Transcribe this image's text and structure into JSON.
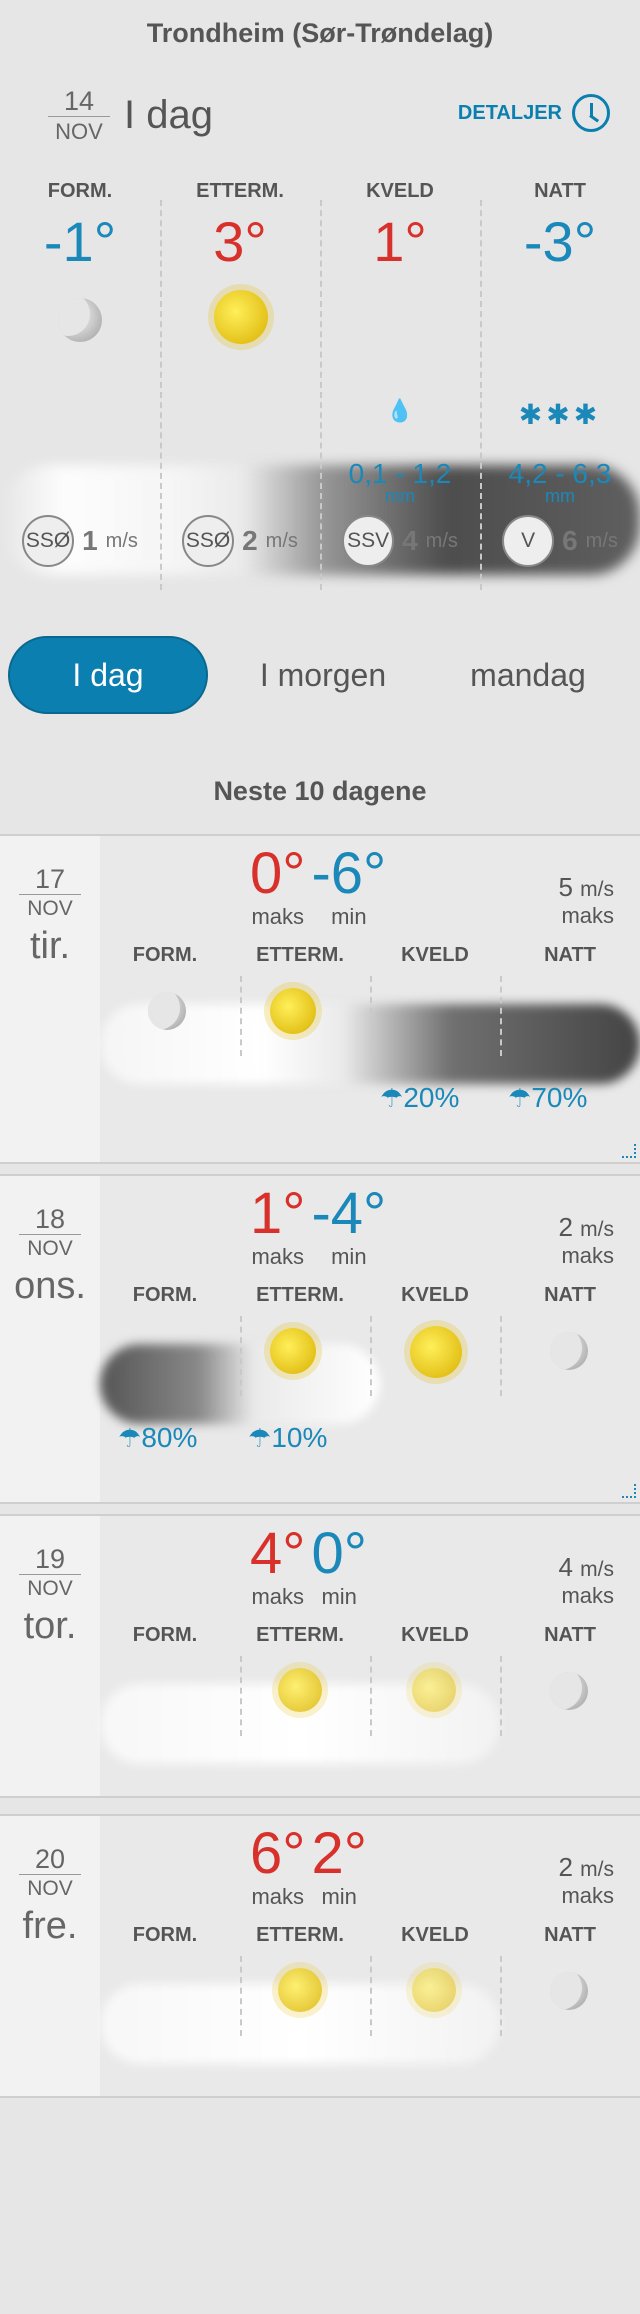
{
  "title": "Trondheim (Sør-Trøndelag)",
  "today": {
    "day": "14",
    "month": "NOV",
    "label": "I dag",
    "details": "DETALJER"
  },
  "periods": [
    {
      "label": "FORM.",
      "temp": "-1°",
      "color": "#1a88b8",
      "icon": "moon-icon",
      "precip": "",
      "precip_unit": "",
      "wind_dir": "SSØ",
      "wind_speed": "1",
      "wind_unit": "m/s"
    },
    {
      "label": "ETTERM.",
      "temp": "3°",
      "color": "#d8302a",
      "icon": "sun-icon",
      "precip": "",
      "precip_unit": "",
      "wind_dir": "SSØ",
      "wind_speed": "2",
      "wind_unit": "m/s"
    },
    {
      "label": "KVELD",
      "temp": "1°",
      "color": "#d8302a",
      "icon": "rain-icon",
      "precip": "0,1 - 1,2",
      "precip_unit": "mm",
      "wind_dir": "SSV",
      "wind_speed": "4",
      "wind_unit": "m/s"
    },
    {
      "label": "NATT",
      "temp": "-3°",
      "color": "#1a88b8",
      "icon": "snow-icon",
      "precip": "4,2 - 6,3",
      "precip_unit": "mm",
      "wind_dir": "V",
      "wind_speed": "6",
      "wind_unit": "m/s"
    }
  ],
  "tabs": [
    "I dag",
    "I morgen",
    "mandag"
  ],
  "next_title": "Neste 10 dagene",
  "col_labels": [
    "FORM.",
    "ETTERM.",
    "KVELD",
    "NATT"
  ],
  "days": [
    {
      "day": "17",
      "month": "NOV",
      "weekday": "tir.",
      "max": "0°",
      "min": "-6°",
      "max_color": "#d8302a",
      "min_color": "#1a88b8",
      "wind": "5",
      "wind_unit": "m/s",
      "wind_label": "maks",
      "max_label": "maks",
      "min_label": "min",
      "rain": [
        "",
        "",
        "20%",
        "70%"
      ]
    },
    {
      "day": "18",
      "month": "NOV",
      "weekday": "ons.",
      "max": "1°",
      "min": "-4°",
      "max_color": "#d8302a",
      "min_color": "#1a88b8",
      "wind": "2",
      "wind_unit": "m/s",
      "wind_label": "maks",
      "max_label": "maks",
      "min_label": "min",
      "rain": [
        "80%",
        "10%",
        "",
        ""
      ]
    },
    {
      "day": "19",
      "month": "NOV",
      "weekday": "tor.",
      "max": "4°",
      "min": "0°",
      "max_color": "#d8302a",
      "min_color": "#1a88b8",
      "wind": "4",
      "wind_unit": "m/s",
      "wind_label": "maks",
      "max_label": "maks",
      "min_label": "min",
      "rain": [
        "",
        "",
        "",
        ""
      ]
    },
    {
      "day": "20",
      "month": "NOV",
      "weekday": "fre.",
      "max": "6°",
      "min": "2°",
      "max_color": "#d8302a",
      "min_color": "#d8302a",
      "wind": "2",
      "wind_unit": "m/s",
      "wind_label": "maks",
      "max_label": "maks",
      "min_label": "min",
      "rain": [
        "",
        "",
        "",
        ""
      ]
    }
  ]
}
